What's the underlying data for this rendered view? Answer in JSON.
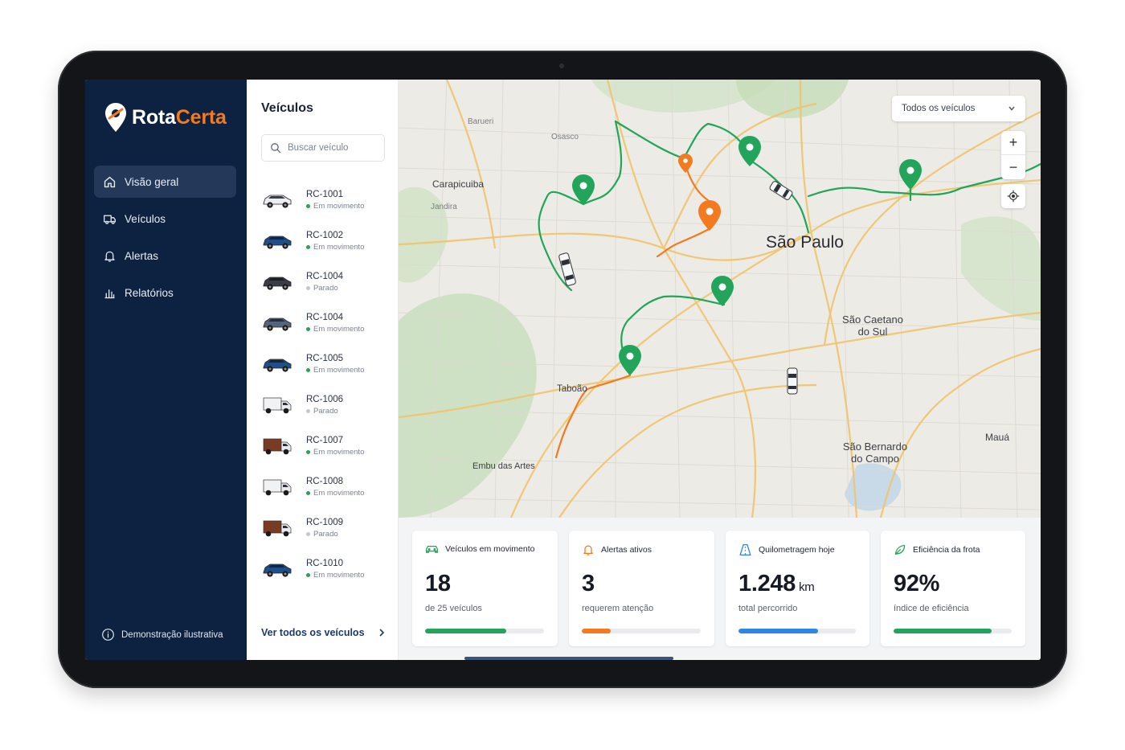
{
  "app": {
    "brand_part1": "Rota",
    "brand_part2": "Certa",
    "colors": {
      "sidebar": "#0d2240",
      "accent": "#f47a20",
      "green": "#22a55a",
      "blue": "#2f86e0"
    }
  },
  "sidebar": {
    "items": [
      {
        "label": "Visão geral",
        "icon": "home-icon",
        "active": true
      },
      {
        "label": "Veículos",
        "icon": "truck-icon",
        "active": false
      },
      {
        "label": "Alertas",
        "icon": "bell-icon",
        "active": false
      },
      {
        "label": "Relatórios",
        "icon": "bar-chart-icon",
        "active": false
      }
    ],
    "footer": "Demonstração ilustrativa"
  },
  "vehicles": {
    "title": "Veículos",
    "search_placeholder": "Buscar veículo",
    "items": [
      {
        "id": "RC-1001",
        "status": "Em movimento",
        "kind": "suv-white"
      },
      {
        "id": "RC-1002",
        "status": "Em movimento",
        "kind": "suv-blue"
      },
      {
        "id": "RC-1004",
        "status": "Parado",
        "kind": "suv-dark"
      },
      {
        "id": "RC-1004",
        "status": "Em movimento",
        "kind": "suv-gray"
      },
      {
        "id": "RC-1005",
        "status": "Em movimento",
        "kind": "suv-blue"
      },
      {
        "id": "RC-1006",
        "status": "Parado",
        "kind": "truck-white"
      },
      {
        "id": "RC-1007",
        "status": "Em movimento",
        "kind": "truck-brown"
      },
      {
        "id": "RC-1008",
        "status": "Em movimento",
        "kind": "truck-white"
      },
      {
        "id": "RC-1009",
        "status": "Parado",
        "kind": "truck-brown"
      },
      {
        "id": "RC-1010",
        "status": "Em movimento",
        "kind": "suv-blue"
      }
    ],
    "view_all": "Ver todos os veículos"
  },
  "map": {
    "filter": "Todos os veículos",
    "zoom_in": "+",
    "zoom_out": "−",
    "labels": {
      "sao_paulo": "São Paulo",
      "sao_caetano_1": "São Caetano",
      "sao_caetano_2": "do Sul",
      "sao_bernardo_1": "São Bernardo",
      "sao_bernardo_2": "do Campo",
      "maua": "Mauá",
      "carapicuiba": "Carapicuiba",
      "embu": "Embu das Artes",
      "taboao": "Taboão",
      "osasco": "Osasco",
      "barueri": "Barueri",
      "jandira": "Jandira"
    }
  },
  "stats": [
    {
      "title": "Veículos em movimento",
      "value": "18",
      "unit": "",
      "subtitle": "de 25 veículos",
      "progress": 0.68,
      "color": "#22a55a",
      "icon": "car-icon"
    },
    {
      "title": "Alertas ativos",
      "value": "3",
      "unit": "",
      "subtitle": "requerem atenção",
      "progress": 0.24,
      "color": "#f47a20",
      "icon": "bell-icon"
    },
    {
      "title": "Quilometragem hoje",
      "value": "1.248",
      "unit": "km",
      "subtitle": "total percorrido",
      "progress": 0.68,
      "color": "#2f86e0",
      "icon": "road-icon"
    },
    {
      "title": "Eficiência da frota",
      "value": "92%",
      "unit": "",
      "subtitle": "índice de eficiência",
      "progress": 0.83,
      "color": "#22a55a",
      "icon": "leaf-icon"
    }
  ]
}
